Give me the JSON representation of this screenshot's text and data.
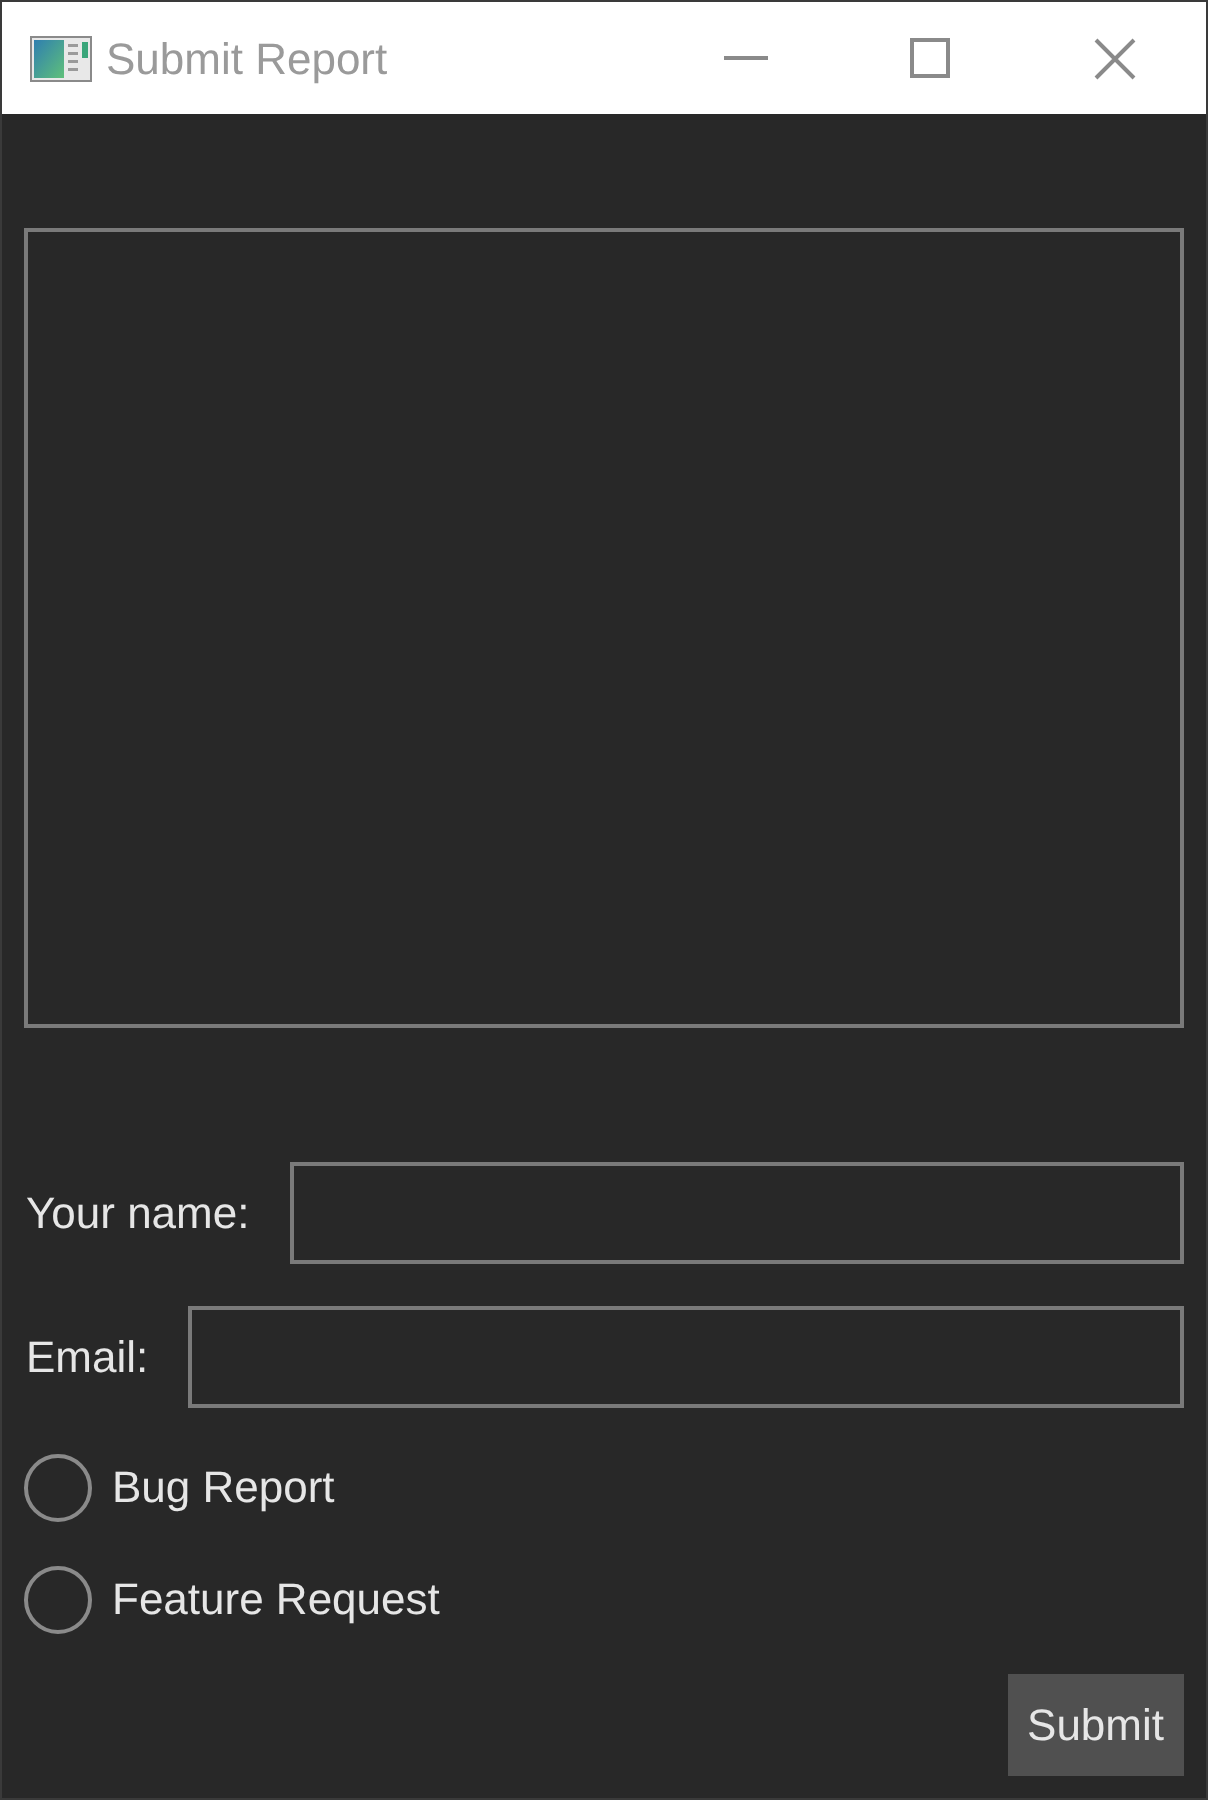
{
  "window": {
    "title": "Submit Report"
  },
  "form": {
    "fields": [
      {
        "label": "Your name:"
      },
      {
        "label": "Email:"
      }
    ],
    "options": [
      {
        "label": "Bug Report",
        "selected": false
      },
      {
        "label": "Feature Request",
        "selected": false
      }
    ],
    "buttons": [
      {
        "label": "Submit"
      }
    ]
  }
}
